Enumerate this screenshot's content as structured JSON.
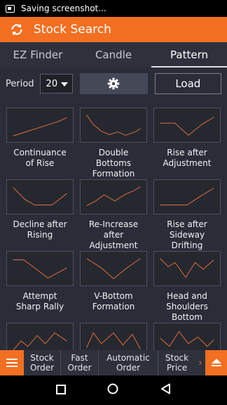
{
  "status_bar": {
    "text": "Saving screenshot..."
  },
  "app_bar": {
    "title": "Stock Search",
    "icon": "refresh-icon"
  },
  "tabs": [
    {
      "label": "EZ Finder",
      "active": false
    },
    {
      "label": "Candle",
      "active": false
    },
    {
      "label": "Pattern",
      "active": true
    }
  ],
  "toolbar": {
    "period_label": "Period",
    "period_value": "20",
    "settings_icon": "gear-icon",
    "load_label": "Load"
  },
  "colors": {
    "accent": "#f36f21",
    "chart_line": "#e0703a",
    "background": "#2a2d38"
  },
  "patterns": [
    {
      "label": "Continuance\nof Rise"
    },
    {
      "label": "Double Bottoms\nFormation"
    },
    {
      "label": "Rise after\nAdjustment"
    },
    {
      "label": "Decline after\nRising"
    },
    {
      "label": "Re-Increase after\nAdjustment"
    },
    {
      "label": "Rise after\nSideway Drifting"
    },
    {
      "label": "Attempt\nSharp Rally"
    },
    {
      "label": "V-Bottom\nFormation"
    },
    {
      "label": "Head and\nShoulders Bottom"
    },
    {
      "label": ""
    },
    {
      "label": ""
    },
    {
      "label": ""
    }
  ],
  "bottom_bar": {
    "items": [
      {
        "label": "Stock\nOrder"
      },
      {
        "label": "Fast\nOrder"
      },
      {
        "label": "Automatic\nOrder"
      },
      {
        "label": "Stock\nPrice"
      }
    ],
    "menu_icon": "menu-icon",
    "next_icon": "chevron-right-icon",
    "up_icon": "eject-up-icon"
  },
  "nav_bar": {
    "icons": [
      "recent-apps-icon",
      "home-icon",
      "back-icon"
    ]
  }
}
